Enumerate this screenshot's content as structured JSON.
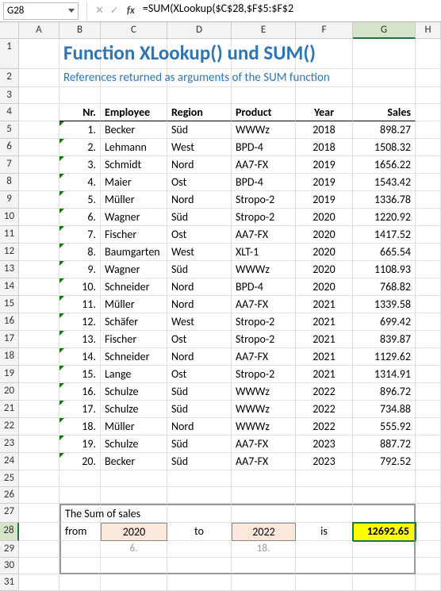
{
  "namebox": "G28",
  "formula": "=SUM(XLookup($C$28,$F$5:$F$2",
  "title": "Function XLookup() und SUM()",
  "subtitle": "References returned as arguments of the SUM function",
  "headers": {
    "nr": "Nr.",
    "employee": "Employee",
    "region": "Region",
    "product": "Product",
    "year": "Year",
    "sales": "Sales"
  },
  "rows": [
    {
      "nr": "1.",
      "emp": "Becker",
      "reg": "Süd",
      "prod": "WWWz",
      "yr": "2018",
      "sales": "898.27"
    },
    {
      "nr": "2.",
      "emp": "Lehmann",
      "reg": "West",
      "prod": "BPD-4",
      "yr": "2018",
      "sales": "1508.32"
    },
    {
      "nr": "3.",
      "emp": "Schmidt",
      "reg": "Nord",
      "prod": "AA7-FX",
      "yr": "2019",
      "sales": "1656.22"
    },
    {
      "nr": "4.",
      "emp": "Maier",
      "reg": "Ost",
      "prod": "BPD-4",
      "yr": "2019",
      "sales": "1543.42"
    },
    {
      "nr": "5.",
      "emp": "Müller",
      "reg": "Nord",
      "prod": "Stropo-2",
      "yr": "2019",
      "sales": "1336.78"
    },
    {
      "nr": "6.",
      "emp": "Wagner",
      "reg": "Süd",
      "prod": "Stropo-2",
      "yr": "2020",
      "sales": "1220.92"
    },
    {
      "nr": "7.",
      "emp": "Fischer",
      "reg": "Ost",
      "prod": "AA7-FX",
      "yr": "2020",
      "sales": "1417.52"
    },
    {
      "nr": "8.",
      "emp": "Baumgarten",
      "reg": "West",
      "prod": "XLT-1",
      "yr": "2020",
      "sales": "665.54"
    },
    {
      "nr": "9.",
      "emp": "Wagner",
      "reg": "Süd",
      "prod": "WWWz",
      "yr": "2020",
      "sales": "1108.93"
    },
    {
      "nr": "10.",
      "emp": "Schneider",
      "reg": "Nord",
      "prod": "BPD-4",
      "yr": "2020",
      "sales": "768.82"
    },
    {
      "nr": "11.",
      "emp": "Müller",
      "reg": "Nord",
      "prod": "AA7-FX",
      "yr": "2021",
      "sales": "1339.58"
    },
    {
      "nr": "12.",
      "emp": "Schäfer",
      "reg": "West",
      "prod": "Stropo-2",
      "yr": "2021",
      "sales": "699.42"
    },
    {
      "nr": "13.",
      "emp": "Fischer",
      "reg": "Ost",
      "prod": "Stropo-2",
      "yr": "2021",
      "sales": "839.87"
    },
    {
      "nr": "14.",
      "emp": "Schneider",
      "reg": "Nord",
      "prod": "AA7-FX",
      "yr": "2021",
      "sales": "1129.62"
    },
    {
      "nr": "15.",
      "emp": "Lange",
      "reg": "Ost",
      "prod": "Stropo-2",
      "yr": "2021",
      "sales": "1314.91"
    },
    {
      "nr": "16.",
      "emp": "Schulze",
      "reg": "Süd",
      "prod": "WWWz",
      "yr": "2022",
      "sales": "896.72"
    },
    {
      "nr": "17.",
      "emp": "Schulze",
      "reg": "Süd",
      "prod": "WWWz",
      "yr": "2022",
      "sales": "734.88"
    },
    {
      "nr": "18.",
      "emp": "Müller",
      "reg": "Nord",
      "prod": "WWWz",
      "yr": "2022",
      "sales": "555.92"
    },
    {
      "nr": "19.",
      "emp": "Schulze",
      "reg": "Süd",
      "prod": "AA7-FX",
      "yr": "2023",
      "sales": "887.72"
    },
    {
      "nr": "20.",
      "emp": "Becker",
      "reg": "Süd",
      "prod": "AA7-FX",
      "yr": "2023",
      "sales": "792.52"
    }
  ],
  "summary": {
    "label": "The Sum of sales",
    "from": "from",
    "year_from": "2020",
    "to": "to",
    "year_to": "2022",
    "is": "is",
    "result": "12692.65",
    "helper_from": "6.",
    "helper_to": "18."
  }
}
